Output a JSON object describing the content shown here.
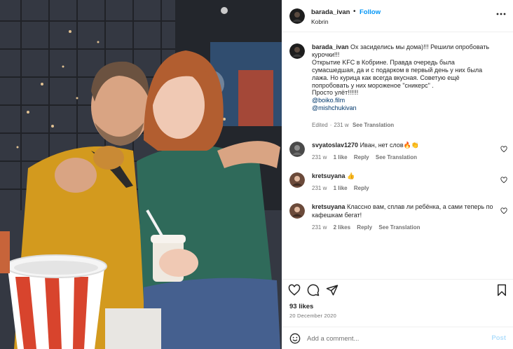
{
  "post": {
    "username": "barada_ivan",
    "follow_label": "Follow",
    "location": "Kobrin",
    "separator": "•"
  },
  "caption": {
    "username": "barada_ivan",
    "lines": [
      "Ох засиделись мы дома)!!! Решили опробовать",
      "курочки!!!",
      "Открытие KFC в Кобрине. Правда очередь была",
      "сумасшедшая, да и с подарком в первый день у них была",
      "лажа. Но курица как всегда вкусная. Советую ещё",
      "попробовать у них мороженое \"сникерс\" .",
      "Просто улёт!!!!!!"
    ],
    "mentions": [
      "@boiko.film",
      "@mishchukivan"
    ],
    "edited": "Edited",
    "time": "231 w",
    "see_translation": "See Translation"
  },
  "comments": [
    {
      "username": "svyatoslav1270",
      "text": "Иван, нет слов🔥👏",
      "time": "231 w",
      "likes": "1 like",
      "reply": "Reply",
      "see_translation": "See Translation"
    },
    {
      "username": "kretsuyana",
      "text": "👍",
      "time": "231 w",
      "likes": "1 like",
      "reply": "Reply"
    },
    {
      "username": "kretsuyana",
      "text": "Классно вам, сплав ли ребёнка, а сами теперь по кафешкам бегат!",
      "time": "231 w",
      "likes": "2 likes",
      "reply": "Reply",
      "see_translation": "See Translation"
    }
  ],
  "stats": {
    "likes": "93 likes",
    "date": "20 December 2020"
  },
  "add_comment": {
    "placeholder": "Add a comment...",
    "post_label": "Post"
  },
  "icons": {
    "more": "more-horizontal-icon",
    "like": "heart-icon",
    "comment": "comment-icon",
    "share": "share-icon",
    "save": "bookmark-icon",
    "emoji": "emoji-icon"
  },
  "colors": {
    "accent": "#0095f6",
    "link": "#00376b",
    "muted": "#737373",
    "text": "#262626"
  }
}
